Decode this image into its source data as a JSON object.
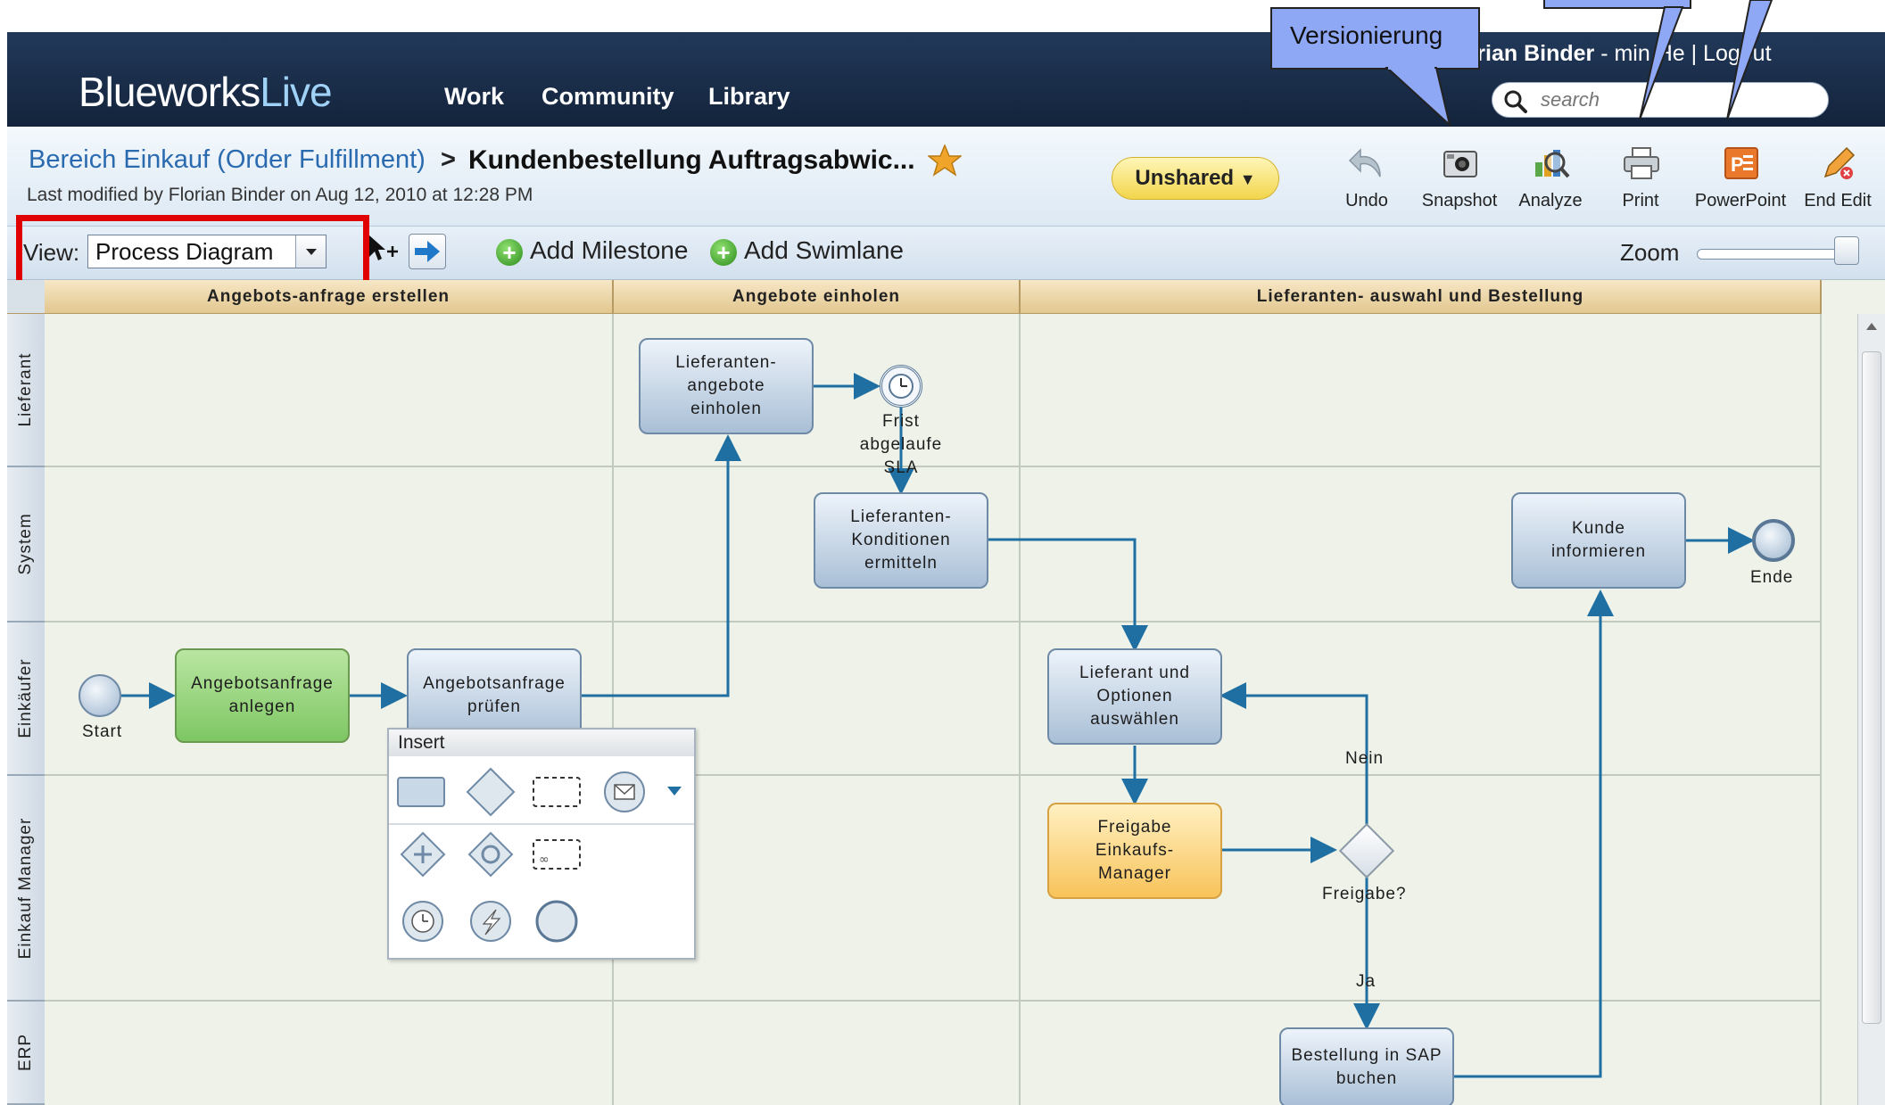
{
  "app": {
    "logo_main": "Blueworks",
    "logo_accent": "Live"
  },
  "nav": {
    "items": [
      "Work",
      "Community",
      "Library"
    ]
  },
  "user": {
    "name": "orian Binder",
    "sep": " - ",
    "admin": "min He",
    "logout": "Logout"
  },
  "search": {
    "placeholder": "search"
  },
  "callout": {
    "versionierung": "Versionierung"
  },
  "breadcrumb": {
    "parent": "Bereich Einkauf (Order Fulfillment)",
    "sep": ">",
    "title": "Kundenbestellung Auftragsabwic..."
  },
  "last_modified": "Last modified by Florian Binder on Aug 12, 2010 at 12:28 PM",
  "share": {
    "label": "Unshared",
    "caret": "▼"
  },
  "tools": [
    {
      "label": "Undo",
      "icon": "undo-icon"
    },
    {
      "label": "Snapshot",
      "icon": "camera-icon"
    },
    {
      "label": "Analyze",
      "icon": "analyze-icon"
    },
    {
      "label": "Print",
      "icon": "printer-icon"
    },
    {
      "label": "PowerPoint",
      "icon": "powerpoint-icon"
    },
    {
      "label": "End Edit",
      "icon": "pencil-icon"
    }
  ],
  "toolbar": {
    "view_label": "View:",
    "view_value": "Process Diagram",
    "add_milestone": "Add Milestone",
    "add_swimlane": "Add Swimlane",
    "zoom_label": "Zoom",
    "zoom_level": 1.0
  },
  "phases": [
    "Angebots-anfrage erstellen",
    "Angebote einholen",
    "Lieferanten- auswahl und Bestellung"
  ],
  "lanes": [
    "Lieferant",
    "System",
    "Einkäufer",
    "Einkauf Manager",
    "ERP"
  ],
  "diagram": {
    "start": "Start",
    "end": "Ende",
    "tasks": {
      "anlegen": "Angebotsanfrage\nanlegen",
      "pruefen": "Angebotsanfrage\nprüfen",
      "einholen": "Lieferanten-\nangebote\neinholen",
      "konditionen": "Lieferanten-\nKonditionen\nermitteln",
      "auswaehlen": "Lieferant und\nOptionen\nauswählen",
      "freigabe": "Freigabe\nEinkaufs-\nManager",
      "sap": "Bestellung in SAP\nbuchen",
      "kunde": "Kunde\ninformieren"
    },
    "timer_label": "Frist\nabgelaufe\nSLA",
    "gateway_label": "Freigabe?",
    "nein": "Nein",
    "ja": "Ja"
  },
  "palette": {
    "title": "Insert"
  },
  "colors": {
    "header_bg": "#1b3050",
    "callout": "#8fa8f5",
    "highlight": "#e10000",
    "link": "#2a6aaf",
    "flow": "#1f6fa3"
  }
}
